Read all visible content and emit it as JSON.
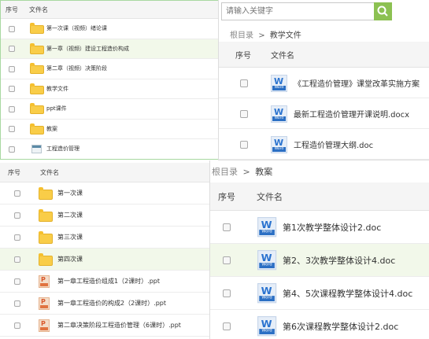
{
  "colors": {
    "green_border": "#a8d8a1",
    "highlight_row": "#f2f8ea",
    "search_btn": "#8cc152",
    "header_bg": "#f5f5f5"
  },
  "panel_top_left": {
    "header": {
      "col_index": "序号",
      "col_name": "文件名"
    },
    "rows": [
      {
        "name": "第一次课（视频）绪论课",
        "icon": "folder-icon"
      },
      {
        "name": "第一章（视频）建设工程造价构成",
        "icon": "folder-icon"
      },
      {
        "name": "第二章（视频）决策阶段",
        "icon": "folder-icon"
      },
      {
        "name": "教学文件",
        "icon": "folder-icon"
      },
      {
        "name": "ppt课件",
        "icon": "folder-icon"
      },
      {
        "name": "教案",
        "icon": "folder-icon"
      },
      {
        "name": "工程造价管理",
        "icon": "image-thumbnail-icon"
      }
    ]
  },
  "panel_top_right": {
    "search": {
      "placeholder": "请输入关键字",
      "icon": "search-icon"
    },
    "breadcrumb": {
      "root": "根目录",
      "sep": ">",
      "current": "教学文件"
    },
    "header": {
      "col_index": "序号",
      "col_name": "文件名"
    },
    "rows": [
      {
        "name": "《工程造价管理》课堂改革实施方案",
        "icon": "word-doc-icon"
      },
      {
        "name": "最新工程造价管理开课说明.docx",
        "icon": "word-doc-icon"
      },
      {
        "name": "工程造价管理大纲.doc",
        "icon": "word-doc-icon"
      }
    ]
  },
  "panel_bottom_left": {
    "header": {
      "col_index": "序号",
      "col_name": "文件名"
    },
    "rows": [
      {
        "name": "第一次课",
        "icon": "folder-icon"
      },
      {
        "name": "第二次课",
        "icon": "folder-icon"
      },
      {
        "name": "第三次课",
        "icon": "folder-icon"
      },
      {
        "name": "第四次课",
        "icon": "folder-icon"
      },
      {
        "name": "第一章工程造价组成1（2课时）.ppt",
        "icon": "ppt-icon"
      },
      {
        "name": "第一章工程造价的构成2（2课时）.ppt",
        "icon": "ppt-icon"
      },
      {
        "name": "第二章决策阶段工程造价管理（6课时）.ppt",
        "icon": "ppt-icon"
      }
    ]
  },
  "panel_bottom_right": {
    "breadcrumb": {
      "root": "根目录",
      "sep": ">",
      "current": "教案"
    },
    "header": {
      "col_index": "序号",
      "col_name": "文件名"
    },
    "rows": [
      {
        "name": "第1次教学整体设计2.doc",
        "icon": "word-doc-icon"
      },
      {
        "name": "第2、3次教学整体设计4.doc",
        "icon": "word-doc-icon"
      },
      {
        "name": "第4、5次课程教学整体设计4.doc",
        "icon": "word-doc-icon"
      },
      {
        "name": "第6次课程教学整体设计2.doc",
        "icon": "word-doc-icon"
      }
    ]
  },
  "word_icon_label": {
    "letter": "W",
    "tag": "Word"
  },
  "ppt_icon_label": {
    "letter": "P"
  }
}
